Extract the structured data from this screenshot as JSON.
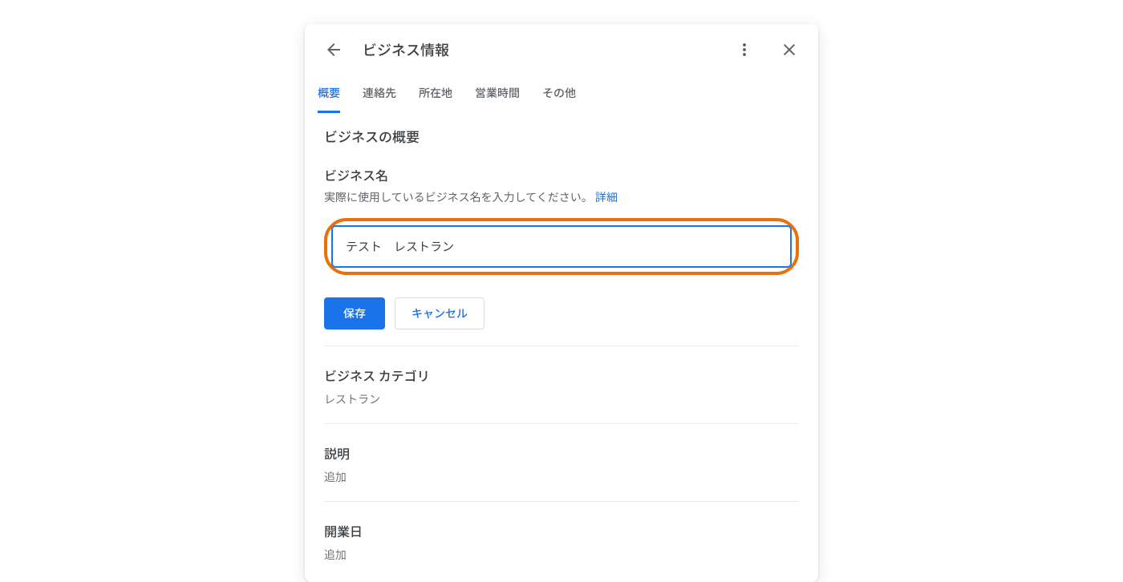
{
  "dialog": {
    "title": "ビジネス情報",
    "tabs": [
      {
        "label": "概要",
        "active": true
      },
      {
        "label": "連絡先",
        "active": false
      },
      {
        "label": "所在地",
        "active": false
      },
      {
        "label": "営業時間",
        "active": false
      },
      {
        "label": "その他",
        "active": false
      }
    ]
  },
  "overview": {
    "heading": "ビジネスの概要",
    "name": {
      "label": "ビジネス名",
      "hint": "実際に使用しているビジネス名を入力してください。",
      "hint_link": "詳細",
      "value": "テスト　レストラン"
    },
    "buttons": {
      "save": "保存",
      "cancel": "キャンセル"
    },
    "category": {
      "label": "ビジネス カテゴリ",
      "value": "レストラン"
    },
    "description": {
      "label": "説明",
      "value": "追加"
    },
    "opening_date": {
      "label": "開業日",
      "value": "追加"
    }
  }
}
